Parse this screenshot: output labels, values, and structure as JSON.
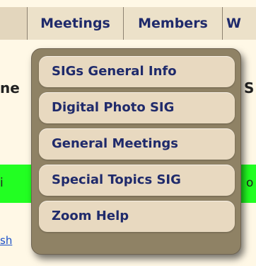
{
  "nav": {
    "tabs": [
      {
        "label": ""
      },
      {
        "label": "Meetings"
      },
      {
        "label": "Members"
      },
      {
        "label": "W"
      }
    ]
  },
  "background_fragments": {
    "left_heading": "ne",
    "right_heading": "S",
    "green_left": "i",
    "green_right": "o",
    "link": "sh"
  },
  "dropdown": {
    "items": [
      {
        "label": "SIGs General Info"
      },
      {
        "label": "Digital Photo SIG"
      },
      {
        "label": "General Meetings"
      },
      {
        "label": "Special Topics SIG"
      },
      {
        "label": "Zoom Help"
      }
    ]
  },
  "colors": {
    "nav_text": "#1f2a6b",
    "dropdown_bg": "#8f8265",
    "menu_item_bg": "#e8d9c0",
    "green_band": "#22ff22"
  }
}
